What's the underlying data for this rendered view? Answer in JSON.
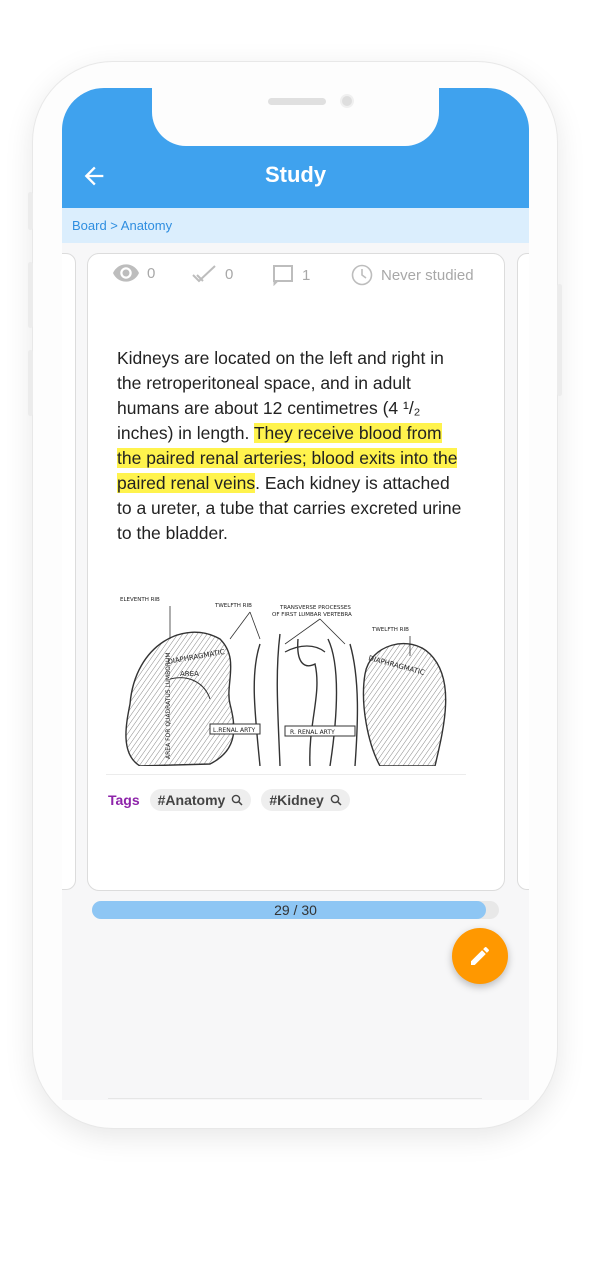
{
  "app": {
    "title": "Study",
    "breadcrumb": "Board > Anatomy"
  },
  "stats": {
    "views": "0",
    "correct": "0",
    "comments": "1",
    "last_studied": "Never studied"
  },
  "card": {
    "text_before": "Kidneys are located on the left and right in the retroperitoneal space, and in adult humans are about 12 centimetres (4 ¹/₂ inches) in length. ",
    "text_highlight": "They receive blood from the paired renal arteries; blood exits into the paired renal veins",
    "text_after": ". Each kidney is attached to a ureter, a tube that carries excreted urine to the bladder.",
    "figure_labels": {
      "eleventh_rib": "ELEVENTH RIB",
      "twelfth_rib_left": "TWELFTH RIB",
      "transverse_1": "TRANSVERSE PROCESSES",
      "transverse_2": "OF FIRST LUMBAR VERTEBRA",
      "twelfth_rib_right": "TWELFTH RIB",
      "diaphragmatic_left": "DIAPHRAGMATIC",
      "area_left": "AREA",
      "renal_arty_left": "L.RENAL ARTY",
      "renal_arty_right": "R. RENAL ARTY",
      "area_for_left": "AREA FOR QUADRATUS LUMBORUM",
      "diaphragmatic_right": "DIAPHRAGMATIC"
    },
    "tags_label": "Tags",
    "tags": [
      "#Anatomy",
      "#Kidney"
    ]
  },
  "progress": {
    "label": "29 / 30",
    "value": 0.967
  },
  "colors": {
    "appbar": "#3fa2ee",
    "highlight": "#fff34d",
    "fab": "#ff9800",
    "tags_label": "#8e24aa"
  },
  "icons": [
    "back-arrow-icon",
    "eye-icon",
    "check-icon",
    "comment-icon",
    "clock-icon",
    "search-icon",
    "pencil-icon"
  ]
}
